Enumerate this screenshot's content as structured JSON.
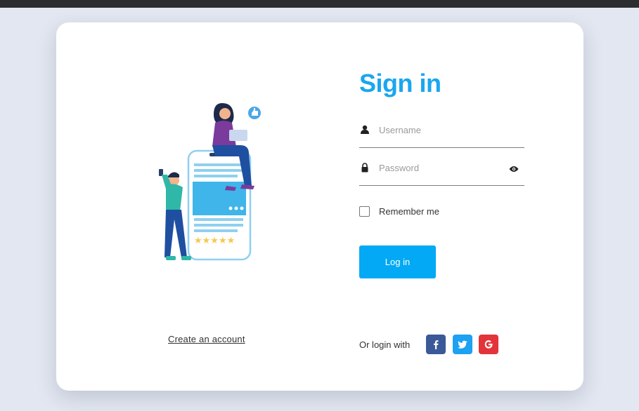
{
  "illustration": {
    "icon": "people-phone-illustration"
  },
  "form": {
    "title": "Sign in",
    "username_placeholder": "Username",
    "password_placeholder": "Password",
    "remember_label": "Remember me",
    "login_label": "Log in"
  },
  "links": {
    "create_account": "Create an account"
  },
  "social": {
    "label": "Or login with",
    "facebook_icon": "facebook-icon",
    "twitter_icon": "twitter-icon",
    "google_icon": "google-icon"
  },
  "colors": {
    "accent": "#1aa6f0",
    "button": "#03a9f4",
    "facebook": "#3b5998",
    "twitter": "#1da1f2",
    "google": "#e2343a",
    "background": "#e2e7f1"
  }
}
